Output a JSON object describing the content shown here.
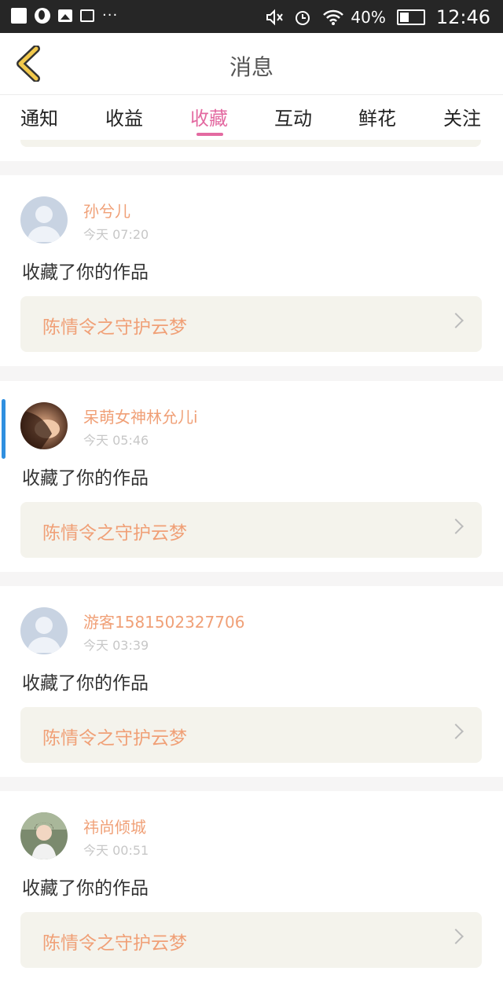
{
  "status_bar": {
    "battery": "40%",
    "battery_level": 0.4,
    "time": "12:46",
    "icons": [
      "notification-icon",
      "globe-icon",
      "image-icon",
      "mail-icon",
      "more-dots-icon",
      "mute-icon",
      "alarm-icon",
      "wifi-icon",
      "battery-icon"
    ]
  },
  "header": {
    "title": "消息",
    "back_icon": "chevron-left-icon",
    "back_color": "#f2c94c"
  },
  "tabs": [
    {
      "label": "通知",
      "active": false
    },
    {
      "label": "收益",
      "active": false
    },
    {
      "label": "收藏",
      "active": true
    },
    {
      "label": "互动",
      "active": false
    },
    {
      "label": "鲜花",
      "active": false
    },
    {
      "label": "关注",
      "active": false
    }
  ],
  "accent_color": "#e36aa1",
  "name_color": "#f0a077",
  "messages": [
    {
      "user": "孙兮儿",
      "time": "今天 07:20",
      "action": "收藏了你的作品",
      "work": "陈情令之守护云梦",
      "avatar": "default-avatar-icon"
    },
    {
      "user": "呆萌女神林允儿i",
      "time": "今天 05:46",
      "action": "收藏了你的作品",
      "work": "陈情令之守护云梦",
      "avatar": "photo-avatar"
    },
    {
      "user": "游客1581502327706",
      "time": "今天 03:39",
      "action": "收藏了你的作品",
      "work": "陈情令之守护云梦",
      "avatar": "default-avatar-icon"
    },
    {
      "user": "祎尚倾城",
      "time": "今天 00:51",
      "action": "收藏了你的作品",
      "work": "陈情令之守护云梦",
      "avatar": "photo-avatar"
    }
  ]
}
